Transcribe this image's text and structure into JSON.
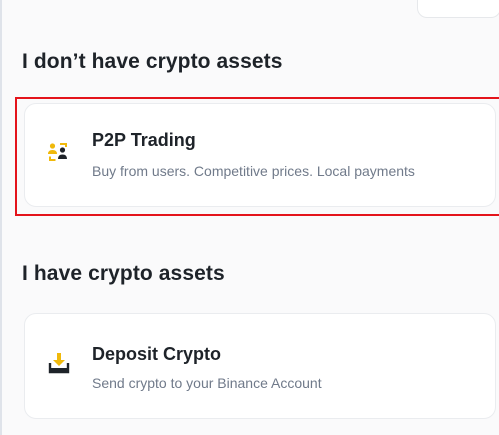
{
  "sections": [
    {
      "title": "I don’t have crypto assets",
      "cards": [
        {
          "icon": "p2p-users-icon",
          "title": "P2P Trading",
          "description": "Buy from users. Competitive prices. Local payments"
        }
      ]
    },
    {
      "title": "I have crypto assets",
      "cards": [
        {
          "icon": "deposit-download-icon",
          "title": "Deposit Crypto",
          "description": "Send crypto to your Binance Account"
        }
      ]
    }
  ],
  "colors": {
    "accent": "#f0b90b",
    "text_primary": "#1e2329",
    "text_secondary": "#707a8a",
    "highlight_border": "#e4141b"
  }
}
